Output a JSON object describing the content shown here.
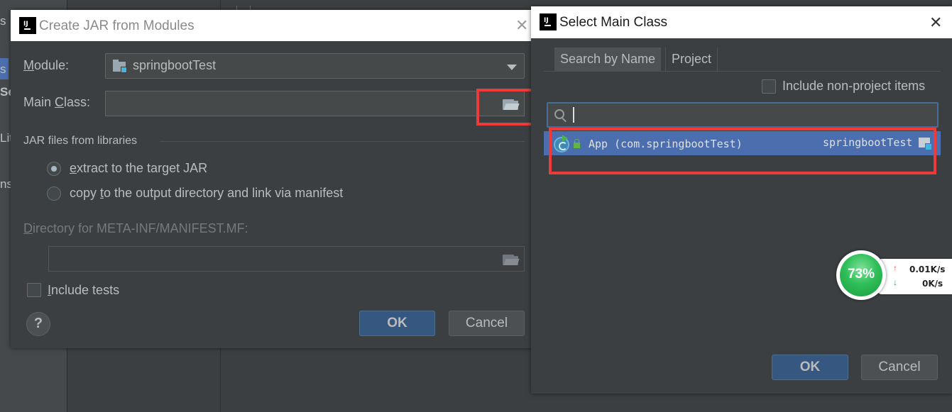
{
  "background": {
    "left_fragments": [
      "s",
      "Se",
      "Lit",
      "ns"
    ]
  },
  "jar_dialog": {
    "title": "Create JAR from Modules",
    "module_label": "Module:",
    "module_mnemonic": "M",
    "module_label_rest": "odule:",
    "module_value": "springbootTest",
    "main_class_label_pre": "Main ",
    "main_class_mnemonic": "C",
    "main_class_label_rest": "lass:",
    "main_class_value": "",
    "section_title": "JAR files from libraries",
    "radio_extract_mnemonic": "e",
    "radio_extract_rest": "xtract to the target JAR",
    "radio_copy_pre": "copy ",
    "radio_copy_mnemonic": "t",
    "radio_copy_rest": "o the output directory and link via manifest",
    "manifest_mnemonic": "D",
    "manifest_rest": "irectory for META-INF/MANIFEST.MF:",
    "manifest_value": "",
    "include_tests_mnemonic": "I",
    "include_tests_rest": "nclude tests",
    "help_label": "?",
    "ok_label": "OK",
    "cancel_label": "Cancel",
    "close_glyph": "✕"
  },
  "main_class_dialog": {
    "title": "Select Main Class",
    "close_glyph": "✕",
    "tabs": [
      {
        "label": "Search by Name",
        "active": true
      },
      {
        "label": "Project",
        "active": false
      }
    ],
    "include_non_project_label": "Include non-project items",
    "search_value": "",
    "results": [
      {
        "class_text": "App (com.springbootTest)",
        "module": "springbootTest",
        "selected": true
      }
    ],
    "ok_label": "OK",
    "cancel_label": "Cancel"
  },
  "net_widget": {
    "percent": "73%",
    "upload": "0.01K/s",
    "download": "0K/s",
    "up_glyph": "↑",
    "down_glyph": "↓"
  },
  "colors": {
    "accent_selection": "#4b6eaf",
    "highlight_red": "#ee3a3a",
    "dialog_bg": "#3c3f41"
  }
}
